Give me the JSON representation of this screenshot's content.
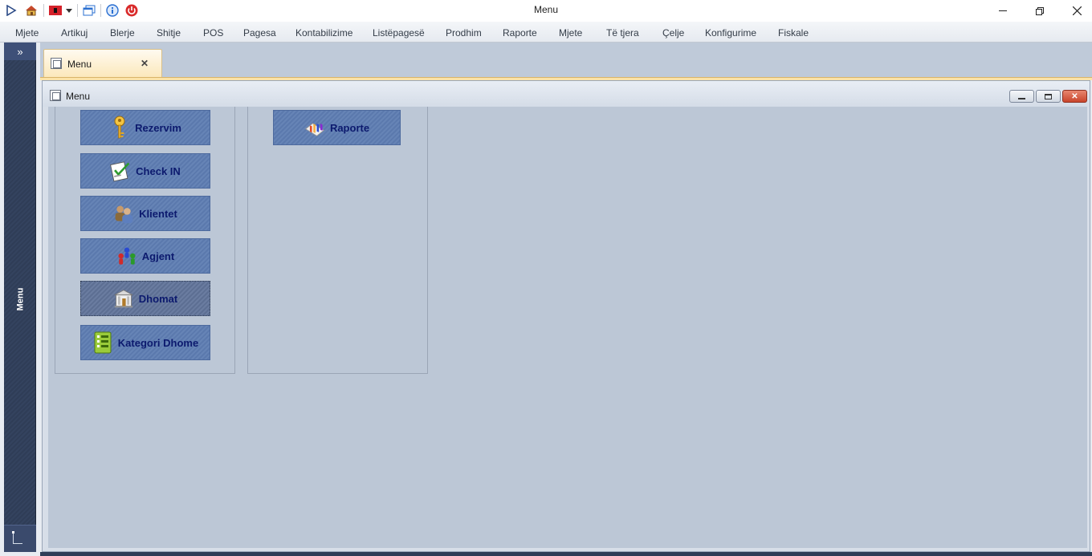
{
  "window": {
    "title": "Menu"
  },
  "menubar": {
    "items": [
      "Mjete",
      "Artikuj",
      "Blerje",
      "Shitje",
      "POS",
      "Pagesa",
      "Kontabilizime",
      "Listëpagesë",
      "Prodhim",
      "Raporte",
      "Mjete",
      "Të tjera",
      "Çelje",
      "Konfigurime",
      "Fiskale"
    ]
  },
  "sidebar": {
    "label": "Menu",
    "toggle_icon": "double-chevron-right-icon"
  },
  "tabs": [
    {
      "label": "Menu",
      "active": true
    }
  ],
  "child_window": {
    "title": "Menu"
  },
  "groups": {
    "left": {
      "tiles": [
        {
          "label": "Rezervim",
          "icon": "key-icon"
        },
        {
          "label": "Check IN",
          "icon": "checklist-icon"
        },
        {
          "label": "Klientet",
          "icon": "users-icon"
        },
        {
          "label": "Agjent",
          "icon": "agents-icon"
        },
        {
          "label": "Dhomat",
          "icon": "building-icon"
        },
        {
          "label": "Kategori Dhome",
          "icon": "list-icon"
        }
      ]
    },
    "right": {
      "tiles": [
        {
          "label": "Raporte",
          "icon": "report-icon"
        }
      ]
    }
  },
  "colors": {
    "tile_fill": "#6282b4",
    "tile_text": "#0c1a6e",
    "sidebar": "#2f3d57",
    "tab_active": "#fbe7b8",
    "close_button": "#c9452c"
  }
}
